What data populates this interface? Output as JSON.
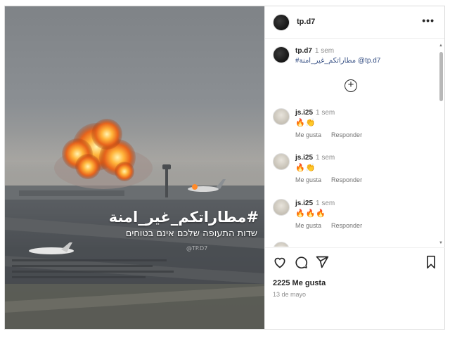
{
  "media": {
    "hashtag_overlay": "#مطاراتكم_غير_امنة",
    "subtitle_overlay": "שדות התעופה שלכם אינם בטוחים",
    "watermark": "@TP.D7"
  },
  "header": {
    "username": "tp.d7",
    "more_icon": "more-horizontal-icon"
  },
  "caption": {
    "username": "tp.d7",
    "time": "1 sem",
    "text": "#مطاراتكم_غير_امنة @tp.d7"
  },
  "comments": [
    {
      "username": "js.i25",
      "time": "1 sem",
      "emojis": "🔥👏",
      "like_label": "Me gusta",
      "reply_label": "Responder"
    },
    {
      "username": "js.i25",
      "time": "1 sem",
      "emojis": "🔥👏",
      "like_label": "Me gusta",
      "reply_label": "Responder"
    },
    {
      "username": "js.i25",
      "time": "1 sem",
      "emojis": "🔥🔥🔥",
      "like_label": "Me gusta",
      "reply_label": "Responder"
    }
  ],
  "footer": {
    "likes": "2225 Me gusta",
    "date": "13 de mayo"
  }
}
